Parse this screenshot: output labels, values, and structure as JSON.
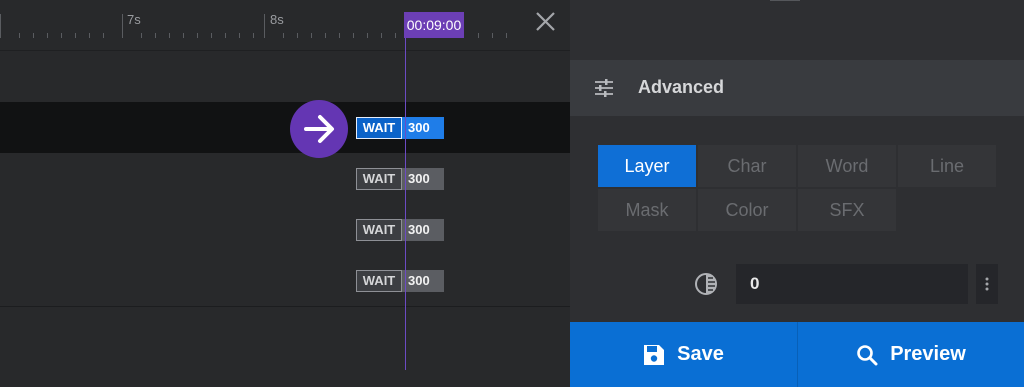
{
  "timeline": {
    "ruler": {
      "labels": [
        "7s",
        "8s"
      ]
    },
    "current_time": "00:09:00",
    "rows": [
      {
        "wait_label": "WAIT",
        "wait_value": "300",
        "active": true
      },
      {
        "wait_label": "WAIT",
        "wait_value": "300",
        "active": false
      },
      {
        "wait_label": "WAIT",
        "wait_value": "300",
        "active": false
      },
      {
        "wait_label": "WAIT",
        "wait_value": "300",
        "active": false
      }
    ]
  },
  "panel": {
    "section_title": "Advanced",
    "tabs": [
      {
        "label": "Layer",
        "active": true
      },
      {
        "label": "Char",
        "active": false
      },
      {
        "label": "Word",
        "active": false
      },
      {
        "label": "Line",
        "active": false
      },
      {
        "label": "Mask",
        "active": false
      },
      {
        "label": "Color",
        "active": false
      },
      {
        "label": "SFX",
        "active": false
      }
    ],
    "opacity_value": "0",
    "save_label": "Save",
    "preview_label": "Preview"
  },
  "colors": {
    "accent_blue": "#0f6fd6",
    "accent_purple": "#6c3fb5",
    "background": "#28292b"
  },
  "icons": [
    "close-icon",
    "arrow-right-icon",
    "sliders-icon",
    "opacity-icon",
    "more-vertical-icon",
    "save-icon",
    "search-icon"
  ]
}
